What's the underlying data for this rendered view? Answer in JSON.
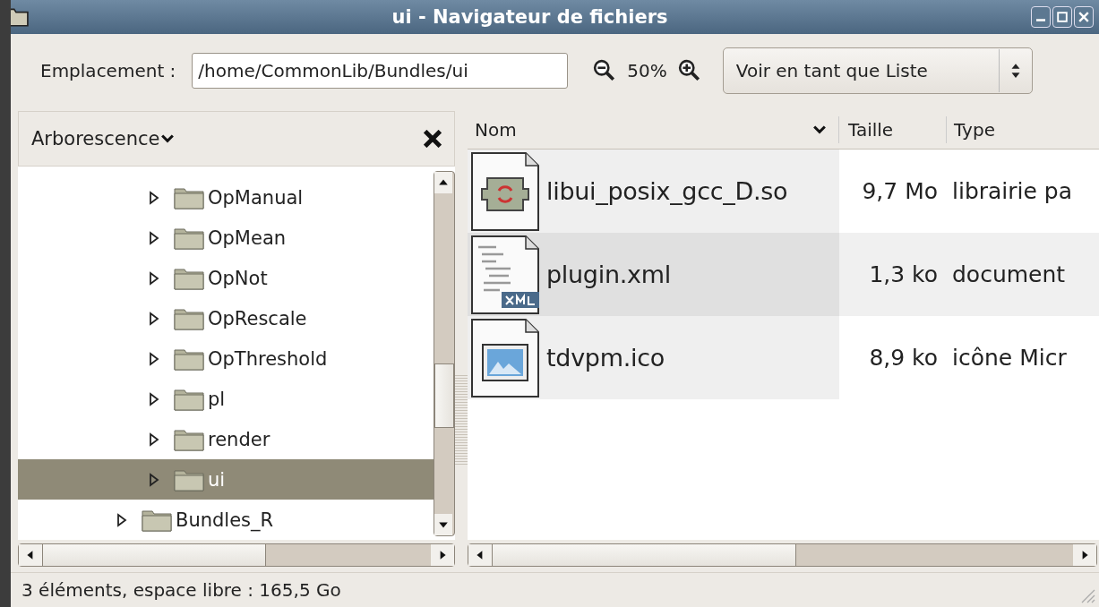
{
  "window": {
    "title": "ui - Navigateur de fichiers"
  },
  "toolbar": {
    "location_label": "Emplacement :",
    "location": "/home/CommonLib/Bundles/ui",
    "zoom": "50%",
    "view": "Voir en tant que Liste"
  },
  "sidebar": {
    "title": "Arborescence",
    "tree": [
      {
        "children": [
          {
            "label": "OpManual",
            "expanded": false,
            "selected": false
          },
          {
            "label": "OpMean",
            "expanded": false,
            "selected": false
          },
          {
            "label": "OpNot",
            "expanded": false,
            "selected": false
          },
          {
            "label": "OpRescale",
            "expanded": false,
            "selected": false
          },
          {
            "label": "OpThreshold",
            "expanded": false,
            "selected": false
          },
          {
            "label": "pl",
            "expanded": false,
            "selected": false
          },
          {
            "label": "render",
            "expanded": false,
            "selected": false
          },
          {
            "label": "ui",
            "expanded": false,
            "selected": true
          }
        ]
      },
      {
        "label": "Bundles_R",
        "expanded": false,
        "selected": false
      }
    ]
  },
  "table": {
    "columns": [
      "Nom",
      "Taille",
      "Type"
    ],
    "rows": [
      {
        "kind": "library",
        "name": "libui_posix_gcc_D.so",
        "size": "9,7 Mo",
        "type": "librairie pa",
        "selected": false
      },
      {
        "kind": "xml",
        "name": "plugin.xml",
        "size": "1,3 ko",
        "type": "document",
        "selected": false
      },
      {
        "kind": "image",
        "name": "tdvpm.ico",
        "size": "8,9 ko",
        "type": "icône Micr",
        "selected": false
      }
    ]
  },
  "status_bar": "3 éléments, espace libre : 165,5 Go"
}
